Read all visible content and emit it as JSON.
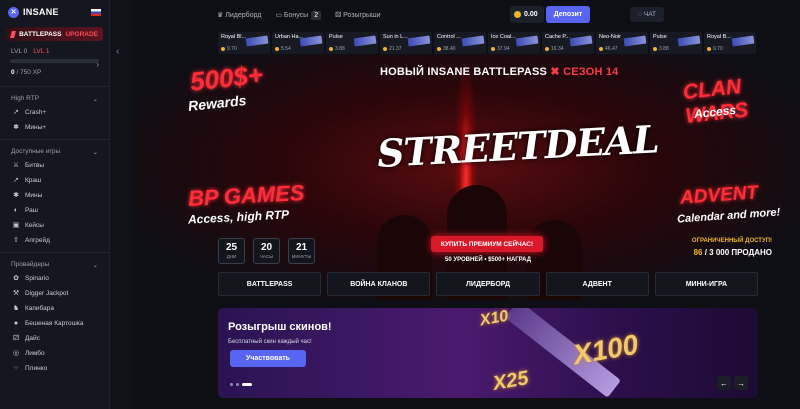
{
  "brand": {
    "name": "INSANE",
    "logo_char": "✕"
  },
  "battlepass": {
    "label": "BATTLEPASS",
    "upgrade": "UPGRADE",
    "lvl_current": "LVL 0",
    "lvl_next": "LVL 1",
    "xp": "0",
    "xp_total": "/ 750 XP",
    "progress": 0
  },
  "sidebar": {
    "sections": [
      {
        "title": "High RTP",
        "items": [
          {
            "label": "Crash+",
            "icon": "rocket-icon"
          },
          {
            "label": "Мины+",
            "icon": "mine-icon"
          }
        ]
      },
      {
        "title": "Доступные игры",
        "items": [
          {
            "label": "Битвы",
            "icon": "swords-icon"
          },
          {
            "label": "Краш",
            "icon": "rocket-icon"
          },
          {
            "label": "Мины",
            "icon": "mine-icon"
          },
          {
            "label": "Раш",
            "icon": "coin-icon"
          },
          {
            "label": "Кейсы",
            "icon": "case-icon"
          },
          {
            "label": "Апгрейд",
            "icon": "upgrade-icon"
          }
        ]
      },
      {
        "title": "Провайдеры",
        "items": [
          {
            "label": "Spinario",
            "icon": "spin-icon"
          },
          {
            "label": "Digger Jackpot",
            "icon": "shovel-icon"
          },
          {
            "label": "Капибара",
            "icon": "animal-icon"
          },
          {
            "label": "Бешеная Картошка",
            "icon": "potato-icon"
          },
          {
            "label": "Дайс",
            "icon": "dice-icon"
          },
          {
            "label": "Лимбо",
            "icon": "limbo-icon"
          },
          {
            "label": "Плинко",
            "icon": "plinko-icon"
          }
        ]
      }
    ]
  },
  "topnav": {
    "leaderboard": "Лидерборд",
    "bonuses": "Бонусы",
    "bonus_count": "2",
    "giveaways": "Розыгрыши"
  },
  "balance": {
    "value": "0.00"
  },
  "deposit_label": "Депозит",
  "chat_label": "ЧАТ",
  "ticker": [
    {
      "name": "Royal Bl...",
      "price": "9.70"
    },
    {
      "name": "Urban Ha...",
      "price": "5.54"
    },
    {
      "name": "Pulse",
      "price": "3.88"
    },
    {
      "name": "Sun in L...",
      "price": "21.37"
    },
    {
      "name": "Control ...",
      "price": "38.40"
    },
    {
      "name": "Ice Coal...",
      "price": "37.94"
    },
    {
      "name": "Cache P...",
      "price": "16.34"
    },
    {
      "name": "Neo-Noir",
      "price": "46.47"
    },
    {
      "name": "Pulse",
      "price": "3.88"
    },
    {
      "name": "Royal B...",
      "price": "9.70"
    }
  ],
  "hero": {
    "title": "НОВЫЙ INSANE BATTLEPASS",
    "season": "СЕЗОН 14",
    "season_mark": "✖",
    "logo": "STREETDEAL",
    "left_top": "500$+",
    "left_top_sub": "Rewards",
    "left_mid": "BP GAMES",
    "left_mid_sub": "Access, high RTP",
    "right_top": "CLAN WARS",
    "right_top_sub": "Access",
    "right_mid": "ADVENT",
    "right_mid_sub": "Calendar and more!",
    "timer": [
      {
        "v": "25",
        "u": "ДНИ"
      },
      {
        "v": "20",
        "u": "ЧАСЫ"
      },
      {
        "v": "21",
        "u": "МИНУТЫ"
      }
    ],
    "buy": "КУПИТЬ ПРЕМИУМ СЕЙЧАС!",
    "levels": "50 УРОВНЕЙ • $500+ НАГРАД",
    "limited": "ОГРАНИЧЕННЫЙ ДОСТУП!",
    "sold": "86",
    "sold_suffix": "/ 3 000 ПРОДАНО"
  },
  "tabs": [
    "BATTLEPASS",
    "ВОЙНА КЛАНОВ",
    "ЛИДЕРБОРД",
    "АДВЕНТ",
    "МИНИ-ИГРА"
  ],
  "promo": {
    "title": "Розыгрыш скинов!",
    "subtitle": "Бесплатный скин каждый час!",
    "button": "Участвовать",
    "mult1": "X10",
    "mult2": "X100",
    "mult3": "X25"
  },
  "colors": {
    "accent": "#5865f2",
    "red": "#ff2d38",
    "gold": "#f0b429"
  }
}
